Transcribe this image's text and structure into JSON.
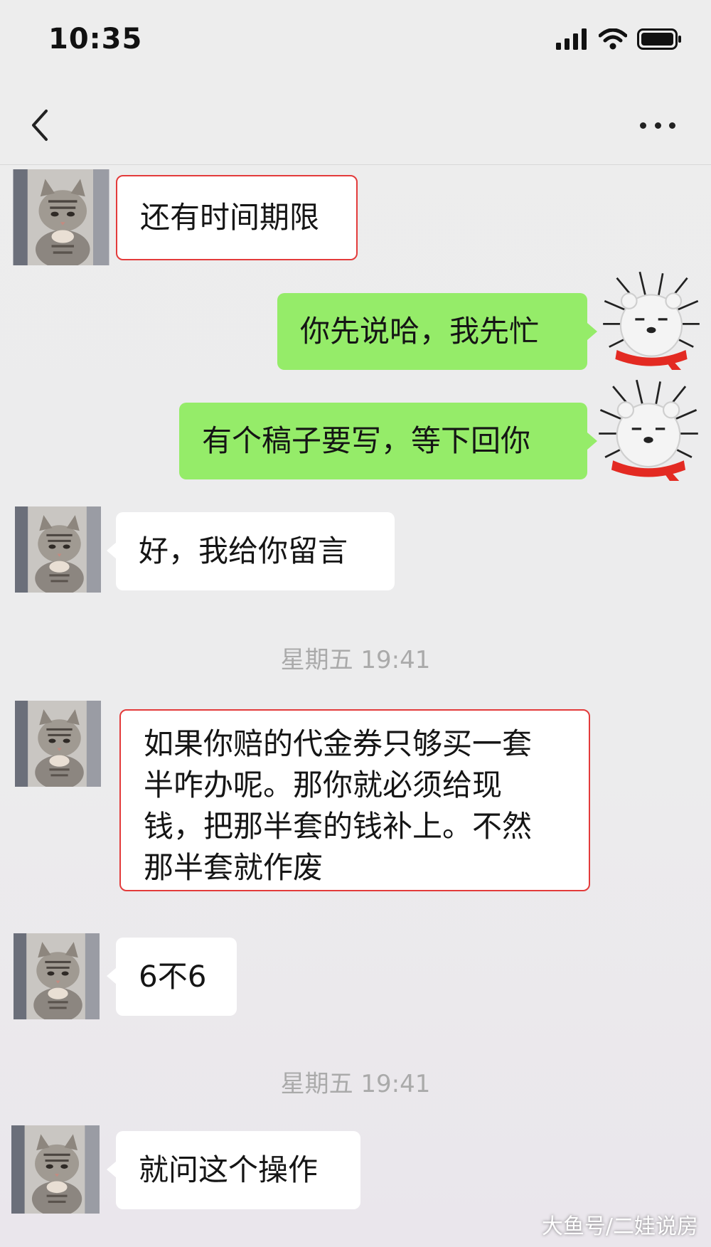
{
  "status_bar": {
    "time": "10:35"
  },
  "nav": {
    "title": ""
  },
  "messages": [
    {
      "side": "left",
      "text": "还有时间期限"
    },
    {
      "side": "right",
      "text": "你先说哈，我先忙"
    },
    {
      "side": "right",
      "text": "有个稿子要写，等下回你"
    },
    {
      "side": "left",
      "text": "好，我给你留言"
    },
    {
      "side": "left",
      "text": "如果你赔的代金券只够买一套\n半咋办呢。那你就必须给现\n钱，把那半套的钱补上。不然\n那半套就作废"
    },
    {
      "side": "left",
      "text": "6不6"
    },
    {
      "side": "left",
      "text": "就问这个操作"
    }
  ],
  "timestamps": [
    "星期五 19:41",
    "星期五 19:41"
  ],
  "watermark": "大鱼号/二娃说房",
  "colors": {
    "green_bubble": "#95ec69",
    "highlight_border": "#e33b3b"
  }
}
